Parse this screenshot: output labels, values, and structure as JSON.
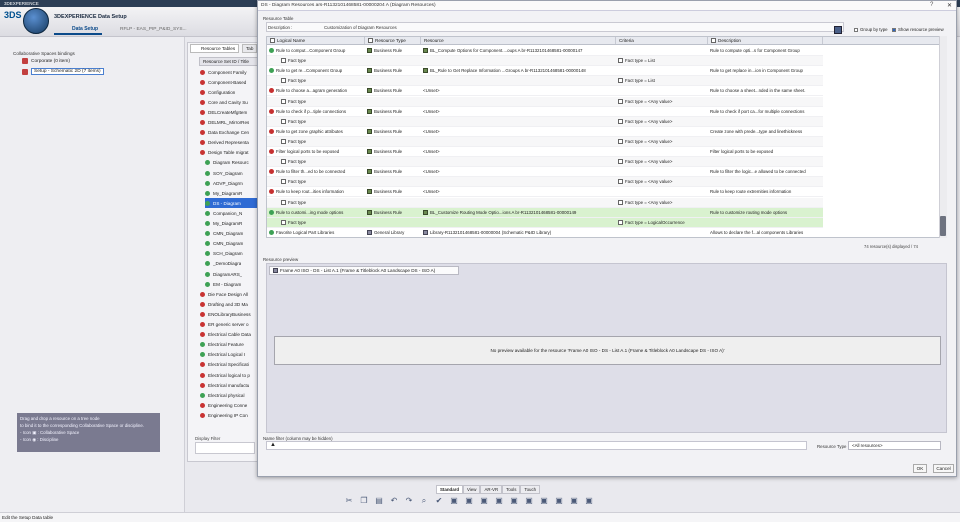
{
  "topbar": {
    "title": "3DEXPERIENCE"
  },
  "app": {
    "name": "3DEXPERIENCE Data Setup",
    "tab_active": "Data Setup",
    "tab_other": "RFLP - EAS_PIP_P&ID_SYS..."
  },
  "left": {
    "collab_title": "Collaborative Spaces bindings",
    "items": [
      {
        "label": "Corporate   (0 item)"
      },
      {
        "label": "Setup - Schematic 2D   (7 items)"
      }
    ],
    "help_lines": [
      "Drag and drop a resource on a tree node",
      "to bind it to the corresponding Collaborative Space or discipline.",
      "- Icon  ▣ : Collaborative Space",
      "- Icon  ◉ : Discipline"
    ]
  },
  "rtables": {
    "tab_label": "Resource Tables",
    "tab2_label": "Tab",
    "header": "Resource Set ID / Title",
    "rows": [
      {
        "label": "Component Family",
        "color": "#c83333"
      },
      {
        "label": "Component-Based",
        "color": "#c83333"
      },
      {
        "label": "Configuration",
        "color": "#c83333"
      },
      {
        "label": "Core and Cavity Su",
        "color": "#c83333"
      },
      {
        "label": "DELCreateMfgItem",
        "color": "#c83333"
      },
      {
        "label": "DELMRL_MirrorRes",
        "color": "#c83333"
      },
      {
        "label": "Data Exchange Cen",
        "color": "#c83333"
      },
      {
        "label": "Derived Representa",
        "color": "#c83333"
      },
      {
        "label": "Design Table migrat",
        "color": "#c83333"
      },
      {
        "label": "Diagram Resourc",
        "color": "#3ea155"
      },
      {
        "label": "SOY_Diagram",
        "color": "#3ea155"
      },
      {
        "label": "ADVP_Diagrm",
        "color": "#3ea155"
      },
      {
        "label": "My_DiagramR",
        "color": "#3ea155"
      },
      {
        "label": "DS - Diagram",
        "color": "#3ea155",
        "selected": true
      },
      {
        "label": "Companion_N",
        "color": "#3ea155"
      },
      {
        "label": "My_DiagramR",
        "color": "#3ea155"
      },
      {
        "label": "CMN_Diagram",
        "color": "#3ea155"
      },
      {
        "label": "CMN_Diagram",
        "color": "#3ea155"
      },
      {
        "label": "SCH_Diagram",
        "color": "#3ea155"
      },
      {
        "label": "_DemoDiagra",
        "color": "#3ea155"
      },
      {
        "label": "DiagramARS_",
        "color": "#3ea155"
      },
      {
        "label": "EM - Diagram",
        "color": "#3ea155"
      },
      {
        "label": "Die Face Design All",
        "color": "#c83333"
      },
      {
        "label": "Drafting and 3D Ma",
        "color": "#c83333"
      },
      {
        "label": "ENOLibraryBusiness",
        "color": "#c83333"
      },
      {
        "label": "ER generic server o",
        "color": "#c83333"
      },
      {
        "label": "Electrical Cable Data",
        "color": "#c83333"
      },
      {
        "label": "Electrical Feature",
        "color": "#3ea155"
      },
      {
        "label": "Electrical Logical I",
        "color": "#3ea155"
      },
      {
        "label": "Electrical Specificati",
        "color": "#c83333"
      },
      {
        "label": "Electrical logical to p",
        "color": "#c83333"
      },
      {
        "label": "Electrical manufactu",
        "color": "#c83333"
      },
      {
        "label": "Electrical physical",
        "color": "#3ea155"
      },
      {
        "label": "Engineering Conne",
        "color": "#c83333"
      },
      {
        "label": "Engineering IP Con",
        "color": "#c83333"
      }
    ],
    "display_filter": "Display Filter"
  },
  "dialog": {
    "title": "DS - Diagram Resources ars-R1132101468581-00000204 A (Diagram Resources)",
    "help": "?",
    "close": "✕",
    "resource_table_label": "Resource Table",
    "description_label": "Description :",
    "description_value": "Customization of Diagram Resources",
    "group_by_type": "Group by type",
    "show_preview": "Show resource preview",
    "columns": [
      "Logical Name",
      "Resource Type",
      "Resource",
      "Criteria",
      "Description"
    ],
    "rows": [
      {
        "kind": "main",
        "icon": "green",
        "name": "Rule to comput...Component Group",
        "type": "Business Rule",
        "resource": "BL_Compute Options for Component....oups A br-R1132101468581-00000147",
        "criteria": "",
        "desc": "Rule to compute opti...s for Component Group"
      },
      {
        "kind": "sub",
        "name": "Fact type",
        "criteria": "Fact type = List"
      },
      {
        "kind": "main",
        "icon": "green",
        "name": "Rule to get re...Component Group",
        "type": "Business Rule",
        "resource": "BL_Rule to Get Replace Information ...Groups A br-R1132101468581-00000148",
        "criteria": "",
        "desc": "Rule to get replace in...ion in Component Group"
      },
      {
        "kind": "sub",
        "name": "Fact type",
        "criteria": "Fact type = List"
      },
      {
        "kind": "main",
        "icon": "red",
        "name": "Rule to choose a...agram generation",
        "type": "Business Rule",
        "resource": "<Unset>",
        "criteria": "",
        "desc": "Rule to choose a sheet...nded in the same sheet."
      },
      {
        "kind": "sub",
        "name": "Fact type",
        "criteria": "Fact type = <Any value>"
      },
      {
        "kind": "main",
        "icon": "red",
        "name": "Rule to check if p...tiple connections",
        "type": "Business Rule",
        "resource": "<Unset>",
        "criteria": "",
        "desc": "Rule to check if port ca...for multiple connections"
      },
      {
        "kind": "sub",
        "name": "Fact type",
        "criteria": "Fact type = <Any value>"
      },
      {
        "kind": "main",
        "icon": "red",
        "name": "Rule to get zone graphic attributes",
        "type": "Business Rule",
        "resource": "<Unset>",
        "criteria": "",
        "desc": "Create zone with prede...type and linethickness"
      },
      {
        "kind": "sub",
        "name": "Fact type",
        "criteria": "Fact type = <Any value>"
      },
      {
        "kind": "main",
        "icon": "red",
        "name": "Filter logical ports to be exposed",
        "type": "Business Rule",
        "resource": "<Unset>",
        "criteria": "",
        "desc": "Filter logical ports to be exposed"
      },
      {
        "kind": "sub",
        "name": "Fact type",
        "criteria": "Fact type = <Any value>"
      },
      {
        "kind": "main",
        "icon": "red",
        "name": "Rule to filter th...ed to be connected",
        "type": "Business Rule",
        "resource": "<Unset>",
        "criteria": "",
        "desc": "Rule to filter the logic...e allowed to be connected"
      },
      {
        "kind": "sub",
        "name": "Fact type",
        "criteria": "Fact type = <Any value>"
      },
      {
        "kind": "main",
        "icon": "red",
        "name": "Rule to keep rout...ities information",
        "type": "Business Rule",
        "resource": "<Unset>",
        "criteria": "",
        "desc": "Rule to keep route extremities information"
      },
      {
        "kind": "sub",
        "name": "Fact type",
        "criteria": "Fact type = <Any value>"
      },
      {
        "kind": "main",
        "icon": "green",
        "highlight": true,
        "name": "Rule to customi...ing mode options",
        "type": "Business Rule",
        "resource": "BL_Customize Routing Mode Optio...ions A br-R1132101468581-00000149",
        "criteria": "",
        "desc": "Rule to customize routing mode options"
      },
      {
        "kind": "sub",
        "highlight": true,
        "name": "Fact type",
        "criteria": "Fact type = LogicalOccurrence"
      },
      {
        "kind": "lib",
        "icon": "green",
        "name": "Favorite Logical Part Libraries",
        "type": "General Library",
        "resource": "Library-R1132101468581-00000004 (Schematic P&ID Library)",
        "criteria": "",
        "desc": "Allows to declare the f...al components Libraries"
      }
    ],
    "count": "74 resource(s) displayed / 74",
    "preview_label": "Resource preview",
    "preview_tab": "Frame A0 ISO - DS - List A.1 (Frame & Titleblock A0 Landscape DS - ISO A)",
    "preview_msg": "No preview available for the resource 'Frame A0 ISO - DS - List A.1 (Frame & Titleblock A0 Landscape DS - ISO A)'",
    "namefilter_label": "Name filter (column may be hidden)",
    "resource_type_label": "Resource Type :",
    "resource_type_value": "<All resources>",
    "ok": "OK",
    "cancel": "Cancel"
  },
  "section_tabs": [
    "Standard",
    "View",
    "AR-VR",
    "Tools",
    "Touch"
  ],
  "toolbar_icons": [
    "cut-icon",
    "copy-icon",
    "paste-icon",
    "undo-icon",
    "redo-icon",
    "zoom-icon",
    "check-icon",
    "tool-icon",
    "tool-icon",
    "tool-icon",
    "tool-icon",
    "tool-icon",
    "tool-icon",
    "tool-icon",
    "tool-icon",
    "tool-icon",
    "tool-icon"
  ],
  "status": {
    "text": "Edit the Setup Data table"
  }
}
